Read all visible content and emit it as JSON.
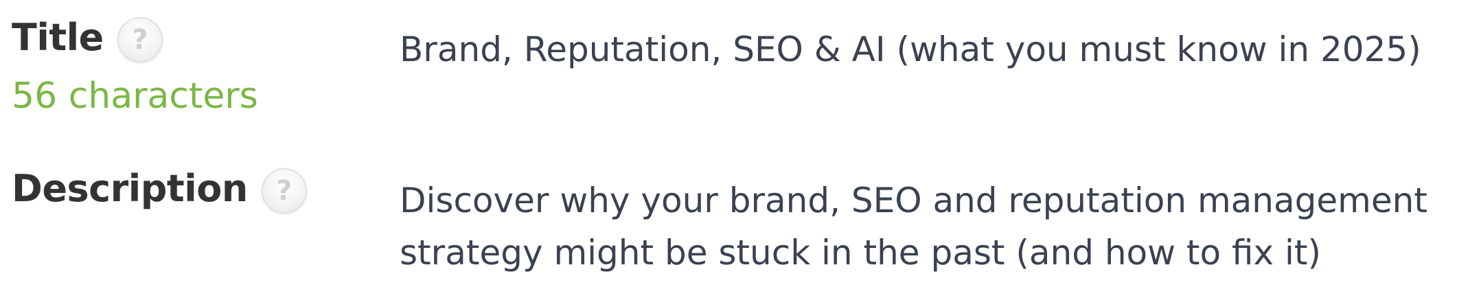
{
  "title_field": {
    "label": "Title",
    "help_icon": "question-mark-icon",
    "char_count": "56 characters",
    "value": "Brand, Reputation, SEO & AI (what you must know in 2025)"
  },
  "description_field": {
    "label": "Description",
    "help_icon": "question-mark-icon",
    "value_lines": [
      "Discover why your brand, SEO and reputation management",
      "strategy might be stuck in the past (and how to fix it)"
    ]
  },
  "colors": {
    "label": "#333333",
    "value": "#3a4150",
    "char_count": "#79b843"
  }
}
